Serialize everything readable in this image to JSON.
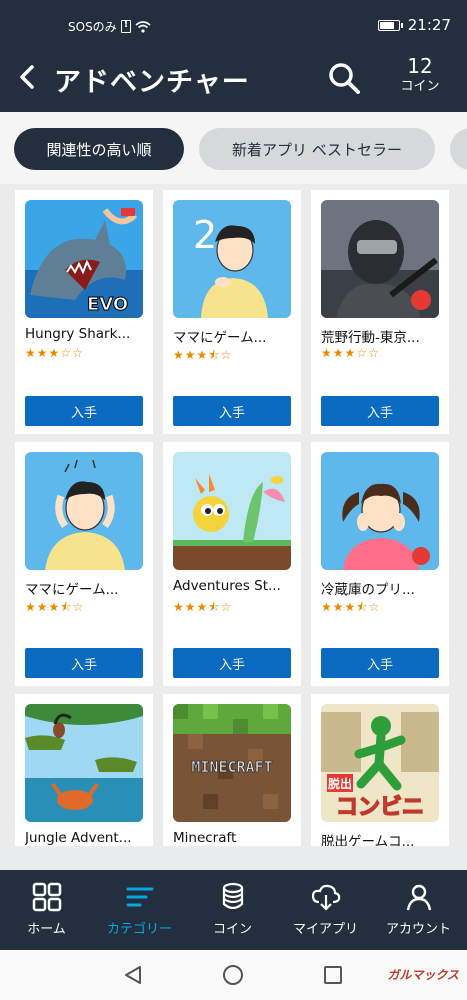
{
  "status_bar": {
    "carrier": "SOSのみ",
    "time": "21:27"
  },
  "header": {
    "title": "アドベンチャー",
    "coins_count": "12",
    "coins_label": "コイン"
  },
  "sort_chips": [
    {
      "label": "関連性の高い順",
      "active": true
    },
    {
      "label": "新着アプリ ベストセラー",
      "active": false
    }
  ],
  "apps": [
    {
      "name": "Hungry Shark...",
      "rating": "★★★☆☆",
      "rating_value": 3,
      "button": "入手",
      "icon": "hungry-shark-icon"
    },
    {
      "name": "ママにゲーム...",
      "rating": "★★★⯪☆",
      "rating_value": 3.5,
      "button": "入手",
      "icon": "mama-game-2-icon"
    },
    {
      "name": "荒野行動-東京...",
      "rating": "★★★☆☆",
      "rating_value": 3,
      "button": "入手",
      "icon": "knives-out-icon"
    },
    {
      "name": "ママにゲーム...",
      "rating": "★★★⯪☆",
      "rating_value": 3.5,
      "button": "入手",
      "icon": "mama-game-icon"
    },
    {
      "name": "Adventures St...",
      "rating": "★★★⯪☆",
      "rating_value": 3.5,
      "button": "入手",
      "icon": "adventures-story-icon"
    },
    {
      "name": "冷蔵庫のプリ...",
      "rating": "★★★⯪☆",
      "rating_value": 3.5,
      "button": "入手",
      "icon": "pudding-icon"
    },
    {
      "name": "Jungle Advent...",
      "rating": "",
      "button": "",
      "icon": "jungle-adventures-icon"
    },
    {
      "name": "Minecraft",
      "rating": "",
      "button": "",
      "icon": "minecraft-icon",
      "logo_text": "MINECRAFT"
    },
    {
      "name": "脱出ゲームコ...",
      "rating": "",
      "button": "",
      "icon": "escape-convenience-icon",
      "logo_text": "コンビニ",
      "badge_text": "脱出"
    }
  ],
  "bottom_nav": [
    {
      "label": "ホーム",
      "icon": "home-grid-icon",
      "active": false
    },
    {
      "label": "カテゴリー",
      "icon": "categories-icon",
      "active": true
    },
    {
      "label": "コイン",
      "icon": "coins-icon",
      "active": false
    },
    {
      "label": "マイアプリ",
      "icon": "cloud-download-icon",
      "active": false
    },
    {
      "label": "アカウント",
      "icon": "account-icon",
      "active": false
    }
  ],
  "colors": {
    "header_bg": "#232f3e",
    "accent": "#00a8e1",
    "button_blue": "#0a6bc1",
    "star": "#e88b00"
  },
  "watermark": "ガルマックス"
}
